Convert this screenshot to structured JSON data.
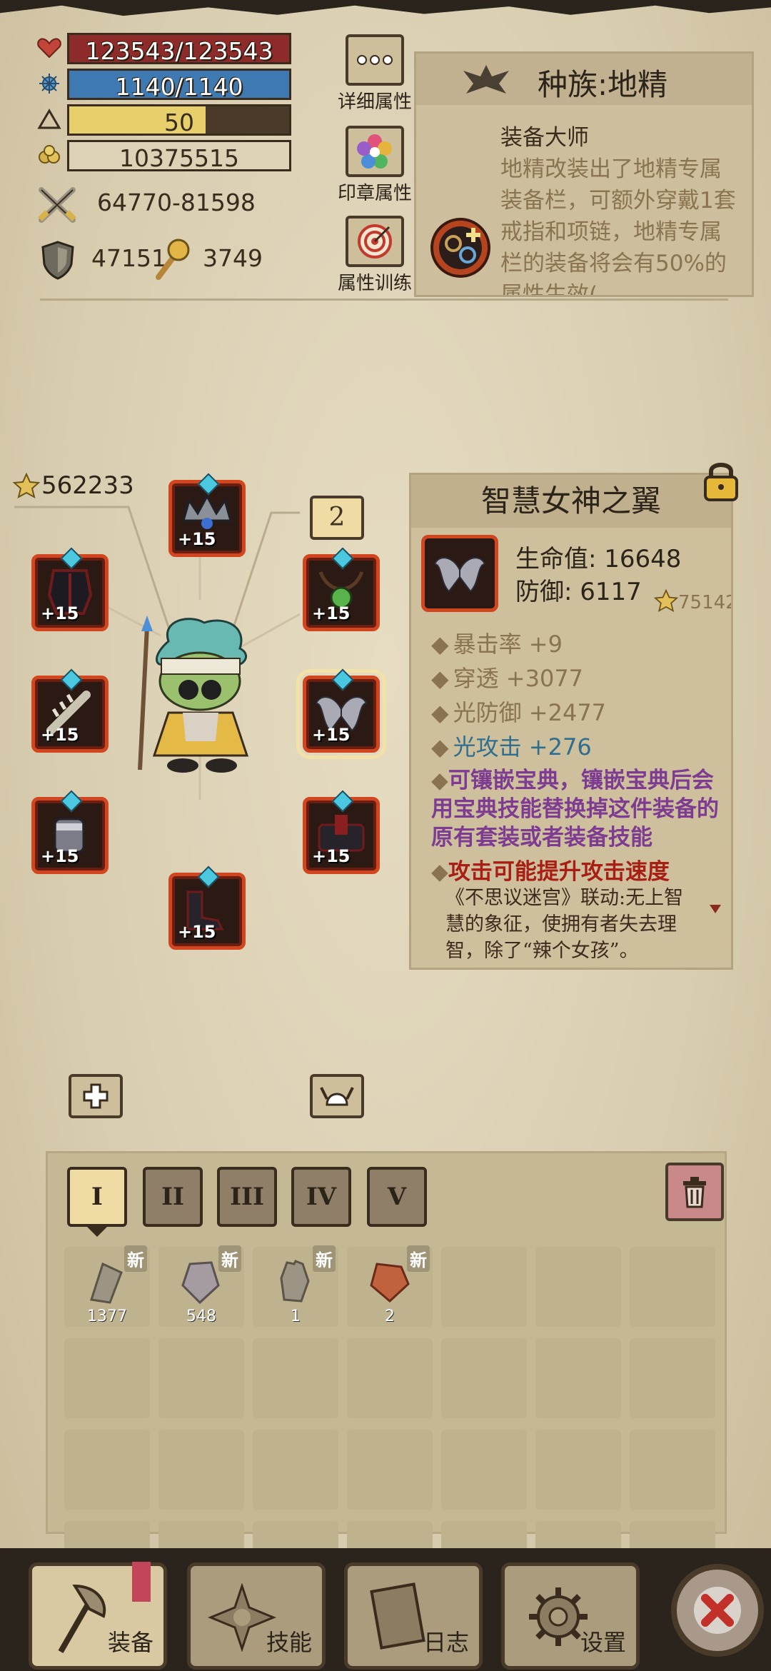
{
  "stats": {
    "hp": "123543/123543",
    "hp_fill": 1.0,
    "mp": "1140/1140",
    "mp_fill": 1.0,
    "level": "50",
    "level_fill": 0.62,
    "gold": "10375515",
    "attack": "64770-81598",
    "defense": "47151",
    "magic": "3749"
  },
  "side_buttons": {
    "detail": "详细属性",
    "seal": "印章属性",
    "train": "属性训练"
  },
  "race": {
    "title": "种族:地精",
    "skill_name": "装备大师",
    "description": "地精改装出了地精专属装备栏，可额外穿戴1套戒指和项链，地精专属栏的装备将会有50%的属性生效("
  },
  "equipment": {
    "rating": "562233",
    "page_number": "2",
    "slot_plus": "+15"
  },
  "item": {
    "name": "智慧女神之翼",
    "hp_line": "生命值: 16648",
    "def_line": "防御: 6117",
    "score": "75142",
    "attrs": [
      {
        "text": "暴击率 +9",
        "color": "#8a7350"
      },
      {
        "text": "穿透 +3077",
        "color": "#8a7350"
      },
      {
        "text": "光防御 +2477",
        "color": "#8a7350"
      },
      {
        "text": "光攻击 +276",
        "color": "#2f6e8e"
      }
    ],
    "inlay_text": "可镶嵌宝典，镶嵌宝典后会用宝典技能替换掉这件装备的原有套装或者装备技能",
    "inlay_color": "#7d3c92",
    "special_text": "攻击可能提升攻击速度",
    "special_color": "#a81d14",
    "flavor": "《不思议迷宫》联动:无上智慧的象征，使拥有者失去理智，除了“辣个女孩”。"
  },
  "tabs": [
    "I",
    "II",
    "III",
    "IV",
    "V"
  ],
  "inventory": [
    {
      "count": "1377",
      "new": "新"
    },
    {
      "count": "548",
      "new": "新"
    },
    {
      "count": "1",
      "new": "新"
    },
    {
      "count": "2",
      "new": "新"
    }
  ],
  "nav": {
    "equip": "装备",
    "skill": "技能",
    "log": "日志",
    "settings": "设置"
  },
  "colors": {
    "hp_bar": "#8d2a2a",
    "mp_bar": "#3f79b1",
    "level_bar": "#e7cf6c",
    "gold_bar": "#ddd2b6",
    "slot_border": "#d2461f"
  }
}
